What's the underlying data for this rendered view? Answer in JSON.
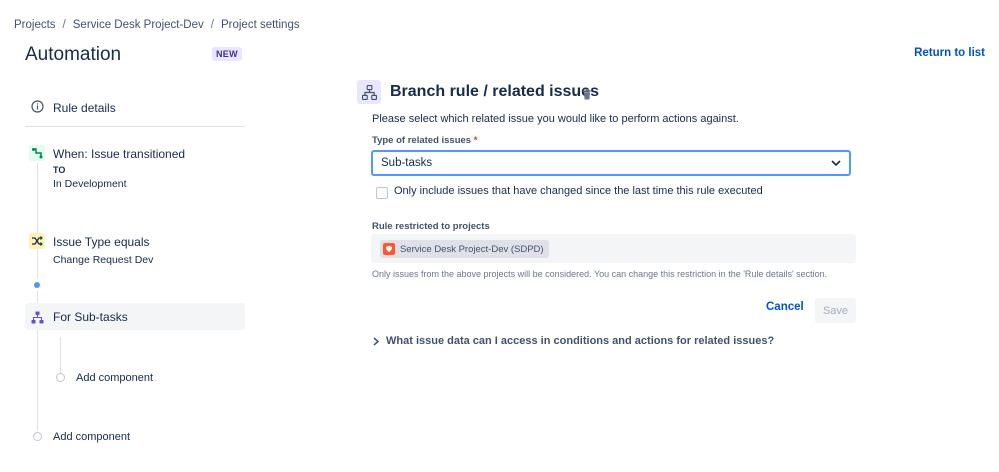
{
  "breadcrumbs": [
    "Projects",
    "Service Desk Project-Dev",
    "Project settings"
  ],
  "header": {
    "title": "Automation",
    "badge": "NEW",
    "return_link": "Return to list"
  },
  "rule_tree": {
    "rule_details": "Rule details",
    "trigger": {
      "title": "When: Issue transitioned",
      "to_label": "TO",
      "to_value": "In Development"
    },
    "condition": {
      "title": "Issue Type equals",
      "value": "Change Request Dev"
    },
    "branch": {
      "title": "For Sub-tasks"
    },
    "add_component_inner": "Add component",
    "add_component_outer": "Add component"
  },
  "panel": {
    "title": "Branch rule / related issues",
    "description": "Please select which related issue you would like to perform actions against.",
    "type_label": "Type of related issues",
    "required_mark": "*",
    "type_value": "Sub-tasks",
    "only_changed_label": "Only include issues that have changed since the last time this rule executed",
    "only_changed_checked": false,
    "projects_label": "Rule restricted to projects",
    "project_chip": "Service Desk Project-Dev (SDPD)",
    "projects_note": "Only issues from the above projects will be considered. You can change this restriction in the 'Rule details' section.",
    "cancel_label": "Cancel",
    "save_label": "Save",
    "faq_label": "What issue data can I access in conditions and actions for related issues?"
  },
  "colors": {
    "link": "#0052cc",
    "focus_border": "#4c9aff",
    "trigger_icon_bg": "#e3fcef",
    "condition_icon_bg": "#fff0b3",
    "branch_icon_bg": "#eae6ff"
  },
  "icons": [
    "info-icon",
    "trigger-icon",
    "shuffle-icon",
    "branch-icon",
    "trash-icon",
    "chevron-down-icon",
    "chevron-right-icon",
    "project-avatar-icon"
  ]
}
